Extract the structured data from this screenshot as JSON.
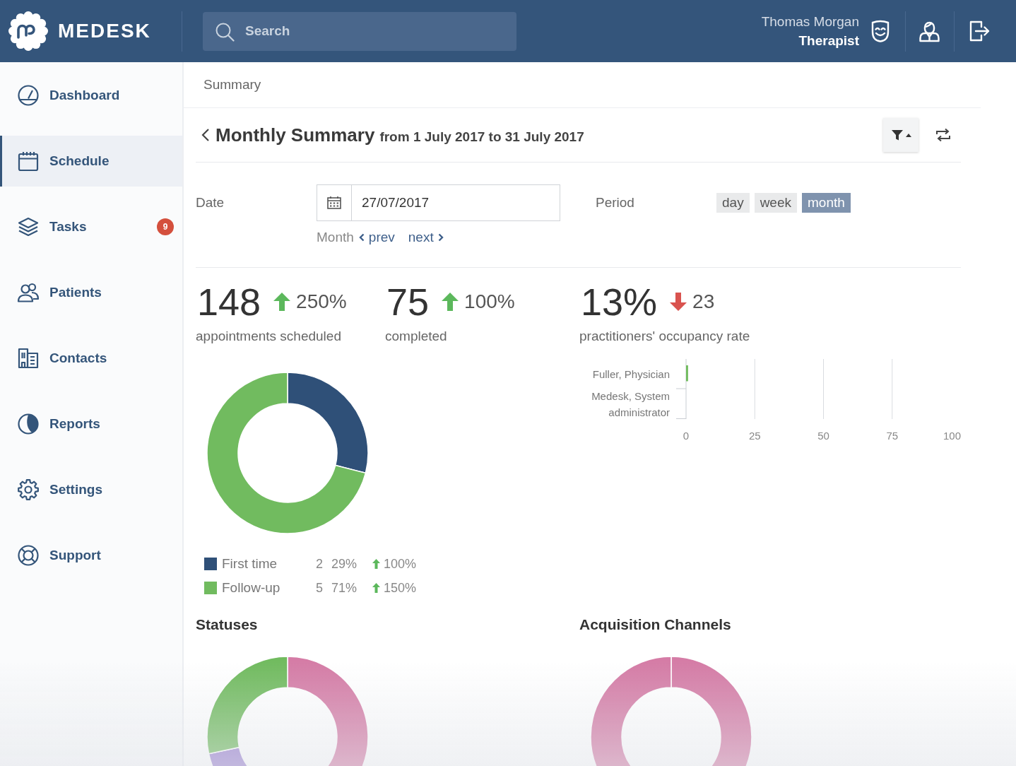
{
  "header": {
    "logo_text": "MEDESK",
    "search": {
      "placeholder": "Search"
    },
    "user": {
      "name": "Thomas Morgan",
      "role": "Therapist"
    }
  },
  "sidebar": {
    "items": [
      {
        "label": "Dashboard",
        "selected": false
      },
      {
        "label": "Schedule",
        "selected": true
      },
      {
        "label": "Tasks",
        "selected": false,
        "badge": "9"
      },
      {
        "label": "Patients",
        "selected": false
      },
      {
        "label": "Contacts",
        "selected": false
      },
      {
        "label": "Reports",
        "selected": false
      },
      {
        "label": "Settings",
        "selected": false
      },
      {
        "label": "Support",
        "selected": false
      }
    ]
  },
  "breadcrumb": "Summary",
  "summary": {
    "title": "Monthly Summary",
    "range": "from 1 July 2017 to 31 July 2017"
  },
  "filters": {
    "date": {
      "label": "Date",
      "value": "27/07/2017"
    },
    "month_nav": {
      "label": "Month",
      "prev": "prev",
      "next": "next"
    },
    "period": {
      "label": "Period",
      "options": [
        {
          "label": "day",
          "selected": false
        },
        {
          "label": "week",
          "selected": false
        },
        {
          "label": "month",
          "selected": true
        }
      ]
    }
  },
  "stats": [
    {
      "value": "148",
      "increase": true,
      "change": "250%",
      "label": "appointments scheduled"
    },
    {
      "value": "75",
      "increase": true,
      "change": "100%",
      "label": "completed"
    },
    {
      "value": "13%",
      "increase": false,
      "change": "23",
      "label": "practitioners' occupancy rate"
    }
  ],
  "appointment_types": {
    "chart_data": {
      "type": "donut",
      "categories": [
        "First time",
        "Follow-up"
      ],
      "values": [
        29,
        71
      ]
    },
    "legend": [
      {
        "color": "#2f5078",
        "count": "2",
        "share": "29%",
        "increase": true,
        "change": "100%"
      },
      {
        "color": "#71bb5f",
        "count": "5",
        "share": "71%",
        "increase": true,
        "change": "150%"
      }
    ]
  },
  "occupancy": {
    "chart_data": {
      "type": "bar",
      "orientation": "horizontal",
      "categories": [
        "Fuller, Physician",
        "Medesk, System administrator"
      ],
      "values": [
        1,
        0
      ],
      "xlim": [
        0,
        100
      ],
      "xticks": [
        0,
        25,
        50,
        75,
        100
      ],
      "grid": true
    }
  },
  "statuses": {
    "title": "Statuses"
  },
  "acquisition_channels": {
    "title": "Acquisition Channels"
  }
}
